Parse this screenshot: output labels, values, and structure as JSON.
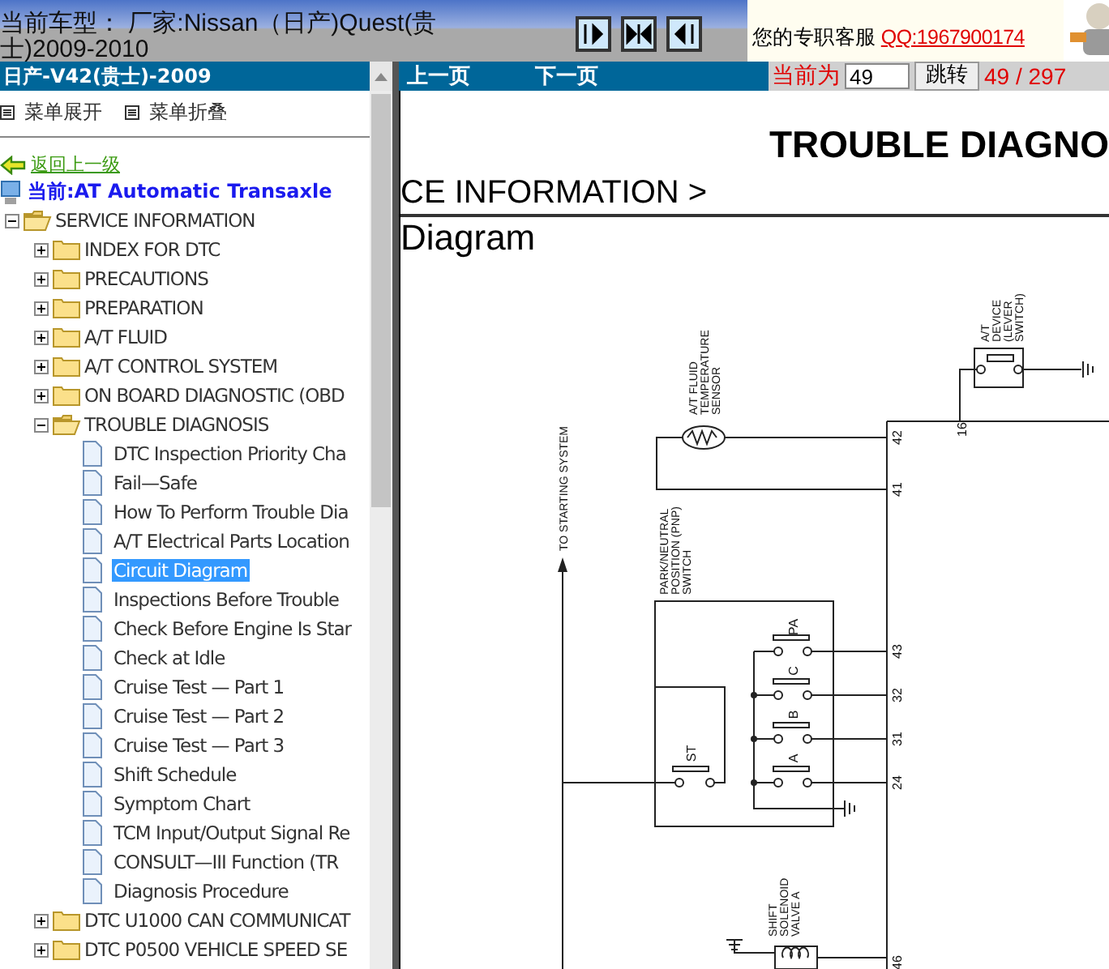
{
  "header": {
    "vehicle": "当前车型： 厂家:Nissan（日产)Quest(贵士)2009-2010",
    "support_label": "您的专职客服",
    "support_qq": "QQ:1967900174"
  },
  "sidebar": {
    "title": "日产-V42(贵士)-2009",
    "tools": [
      "菜单展开",
      "菜单折叠"
    ],
    "back_link": "返回上一级",
    "current": "当前:AT Automatic Transaxle",
    "tree": [
      {
        "kind": "folder",
        "label": "SERVICE INFORMATION",
        "expanded": true,
        "selected": false,
        "children": [
          {
            "kind": "folder",
            "label": "INDEX FOR DTC",
            "expanded": false,
            "selected": false
          },
          {
            "kind": "folder",
            "label": "PRECAUTIONS",
            "expanded": false,
            "selected": false
          },
          {
            "kind": "folder",
            "label": "PREPARATION",
            "expanded": false,
            "selected": false
          },
          {
            "kind": "folder",
            "label": "A/T FLUID",
            "expanded": false,
            "selected": false
          },
          {
            "kind": "folder",
            "label": "A/T CONTROL SYSTEM",
            "expanded": false,
            "selected": false
          },
          {
            "kind": "folder",
            "label": "ON BOARD DIAGNOSTIC (OBD",
            "expanded": false,
            "selected": false
          },
          {
            "kind": "folder",
            "label": "TROUBLE DIAGNOSIS",
            "expanded": true,
            "selected": false,
            "children": [
              {
                "kind": "page",
                "label": "DTC Inspection Priority Cha",
                "selected": false
              },
              {
                "kind": "page",
                "label": "Fail—Safe",
                "selected": false
              },
              {
                "kind": "page",
                "label": "How To Perform Trouble Dia",
                "selected": false
              },
              {
                "kind": "page",
                "label": "A/T Electrical Parts Location",
                "selected": false
              },
              {
                "kind": "page",
                "label": "Circuit Diagram",
                "selected": true
              },
              {
                "kind": "page",
                "label": "Inspections Before Trouble",
                "selected": false
              },
              {
                "kind": "page",
                "label": "Check Before Engine Is Star",
                "selected": false
              },
              {
                "kind": "page",
                "label": "Check at Idle",
                "selected": false
              },
              {
                "kind": "page",
                "label": "Cruise Test — Part 1",
                "selected": false
              },
              {
                "kind": "page",
                "label": "Cruise Test — Part 2",
                "selected": false
              },
              {
                "kind": "page",
                "label": "Cruise Test — Part 3",
                "selected": false
              },
              {
                "kind": "page",
                "label": "Shift Schedule",
                "selected": false
              },
              {
                "kind": "page",
                "label": "Symptom Chart",
                "selected": false
              },
              {
                "kind": "page",
                "label": "TCM Input/Output Signal Re",
                "selected": false
              },
              {
                "kind": "page",
                "label": "CONSULT—III Function (TR",
                "selected": false
              },
              {
                "kind": "page",
                "label": "Diagnosis Procedure",
                "selected": false
              }
            ]
          },
          {
            "kind": "folder",
            "label": "DTC U1000 CAN COMMUNICAT",
            "expanded": false,
            "selected": false
          },
          {
            "kind": "folder",
            "label": "DTC P0500 VEHICLE SPEED SE",
            "expanded": false,
            "selected": false
          }
        ]
      }
    ]
  },
  "nav": {
    "prev": "上一页",
    "next": "下一页",
    "page_label": "当前为",
    "page_input": "49",
    "go": "跳转",
    "page_count": "49 / 297"
  },
  "document": {
    "title": "TROUBLE DIAGNO",
    "breadcrumb": "CE INFORMATION >",
    "heading": "Diagram",
    "diagram": {
      "labels": [
        {
          "lines": [
            "TO STARTING SYSTEM"
          ]
        },
        {
          "lines": [
            "A/T FLUID",
            "TEMPERATURE",
            "SENSOR"
          ]
        },
        {
          "lines": [
            "A/T",
            "DEVICE",
            "(LEVER",
            "SWITCH)"
          ]
        },
        {
          "lines": [
            "PARK/NEUTRAL",
            "POSITION (PNP)",
            "SWITCH"
          ]
        },
        {
          "lines": [
            "SHIFT",
            "SOLENOID",
            "VALVE A"
          ]
        }
      ],
      "pins": [
        "42",
        "41",
        "16",
        "43",
        "32",
        "31",
        "24",
        "46"
      ],
      "contacts": [
        "PA",
        "C",
        "B",
        "A",
        "ST"
      ]
    }
  }
}
